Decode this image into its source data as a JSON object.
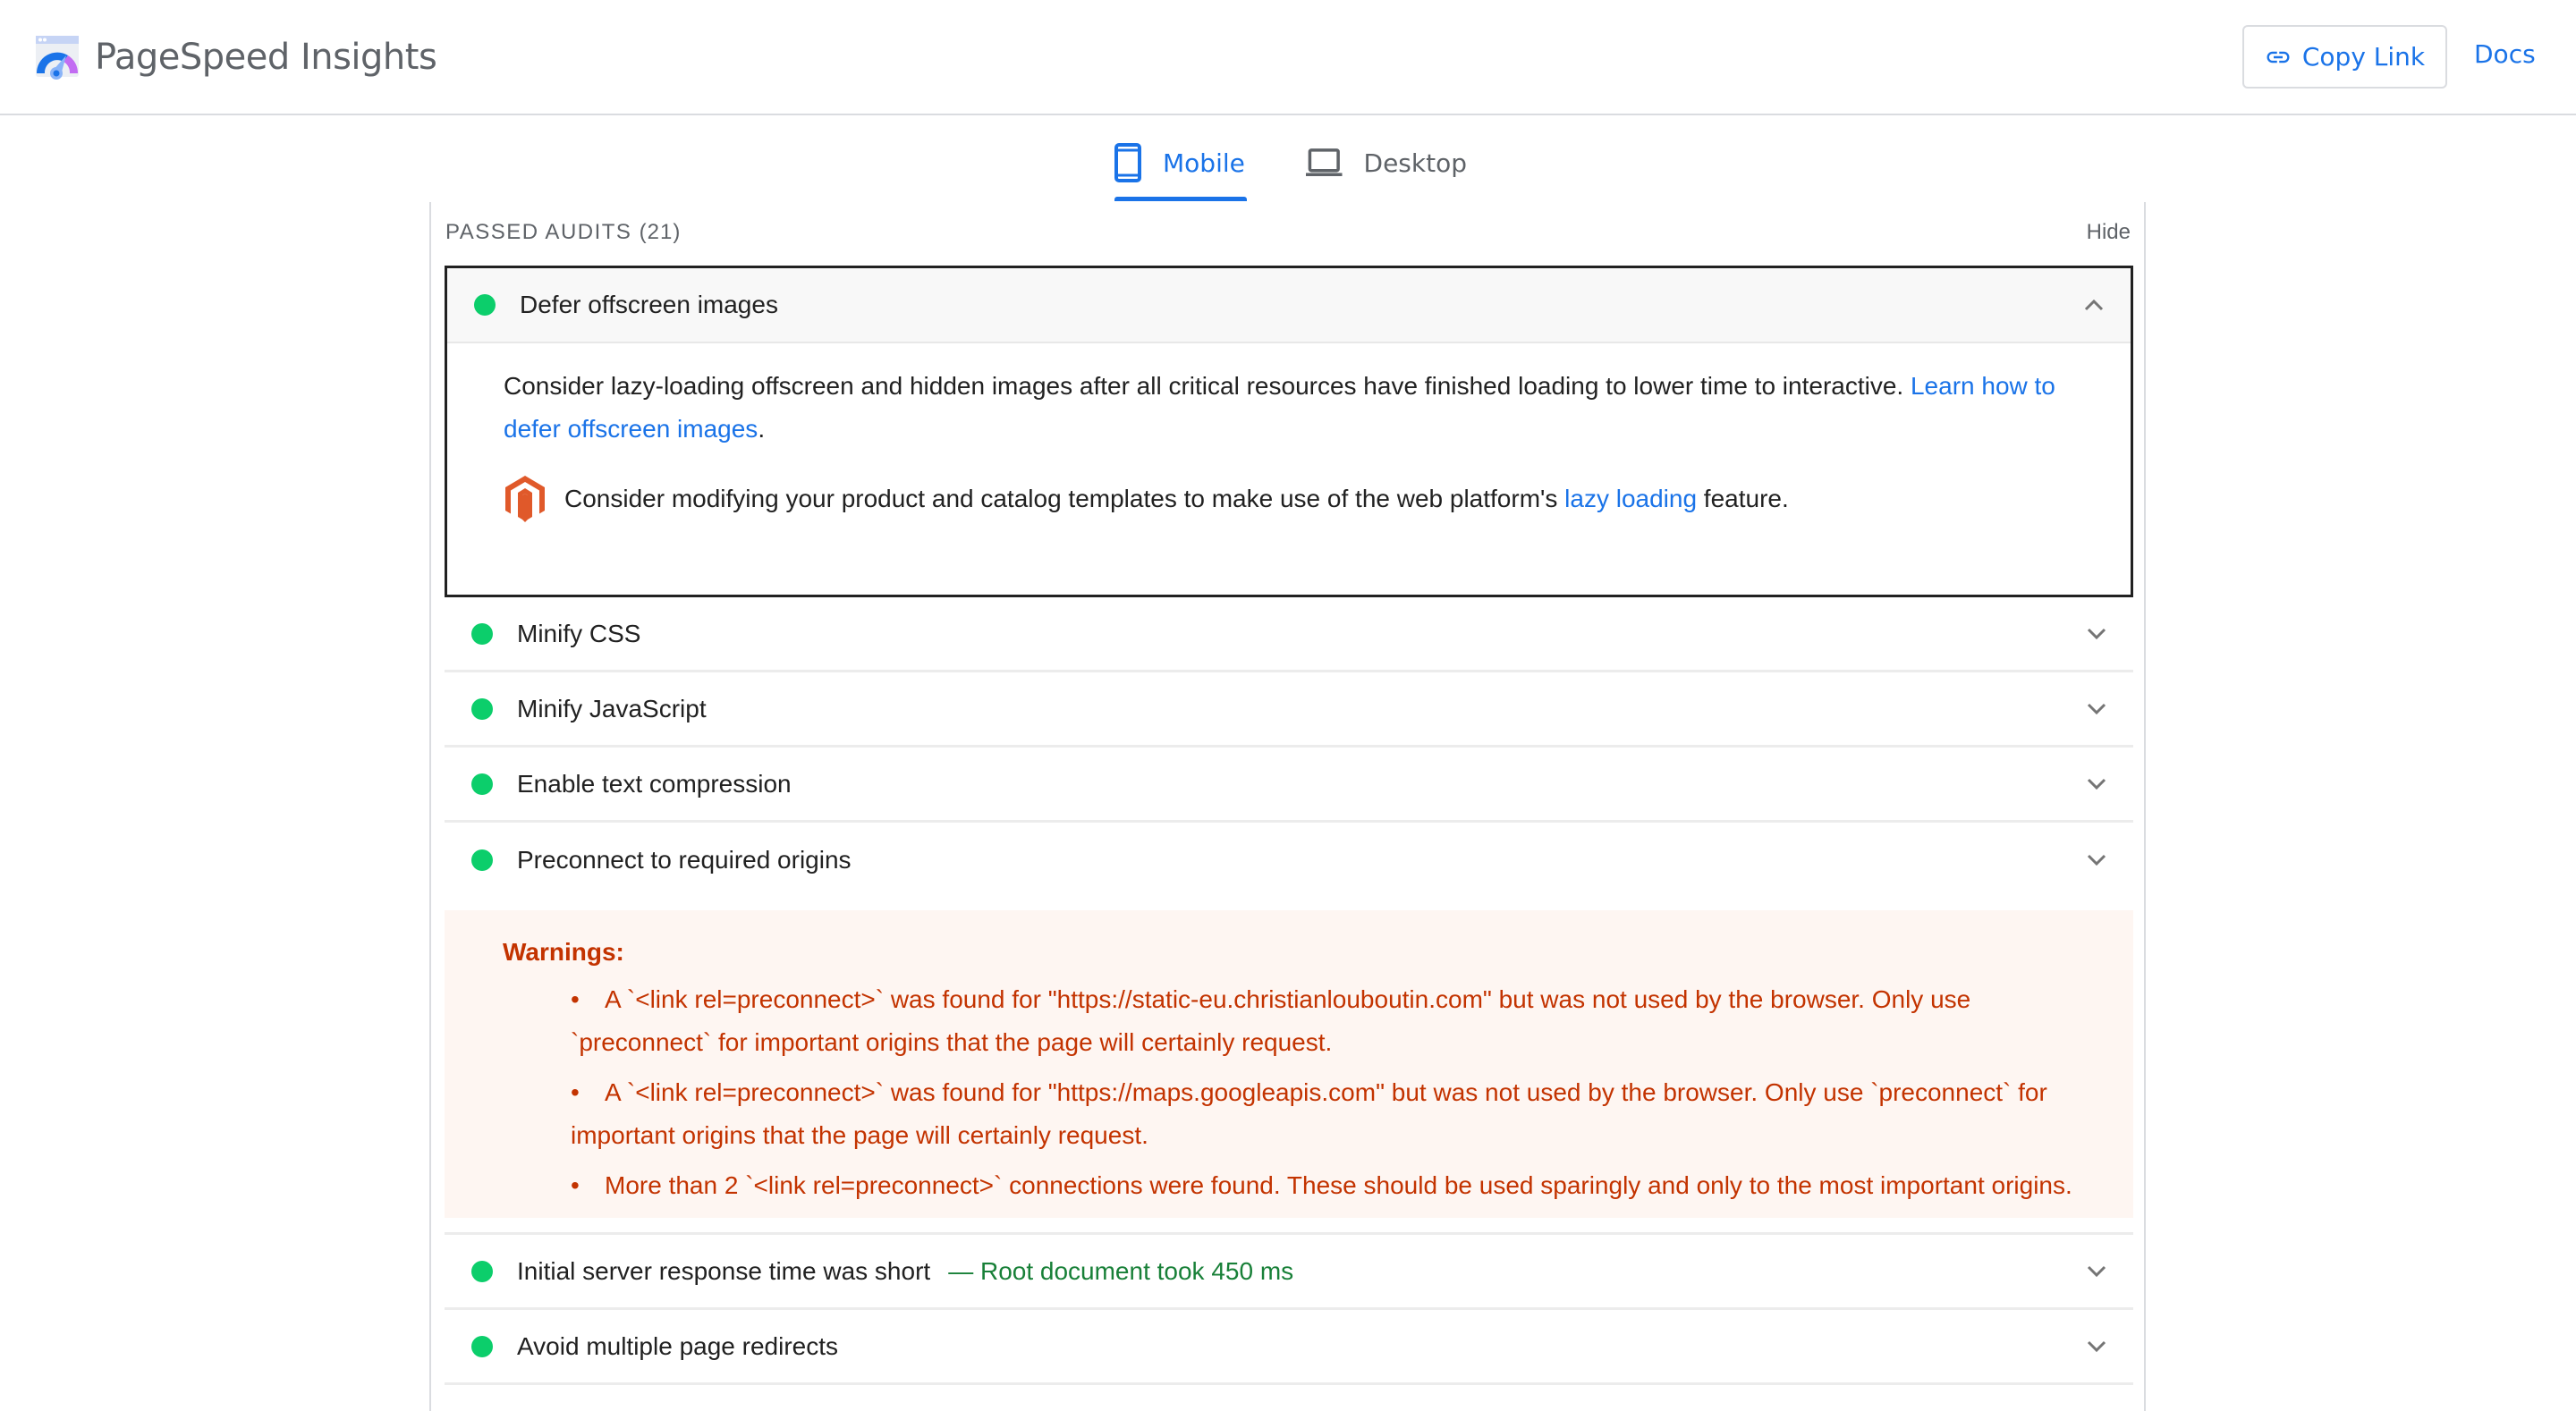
{
  "header": {
    "app_title": "PageSpeed Insights",
    "logo_icon": "pagespeed-gauge-icon",
    "copy_link_label": "Copy Link",
    "copy_link_icon": "link-icon",
    "docs_label": "Docs"
  },
  "tabs": [
    {
      "label": "Mobile",
      "icon": "smartphone-icon",
      "active": true
    },
    {
      "label": "Desktop",
      "icon": "laptop-icon",
      "active": false
    }
  ],
  "colors": {
    "accent": "#1a73e8",
    "pass": "#0cce6b",
    "warning_text": "#c33300",
    "warning_bg": "#fef6f2",
    "display_value": "#188038"
  },
  "section": {
    "title": "PASSED AUDITS",
    "count": "(21)",
    "hide_label": "Hide"
  },
  "expanded_audit": {
    "title": "Defer offscreen images",
    "status": "pass",
    "description_text": "Consider lazy-loading offscreen and hidden images after all critical resources have finished loading to lower time to interactive. ",
    "description_link": "Learn how to defer offscreen images",
    "description_end": ".",
    "stack_pack": {
      "icon": "magento-icon",
      "text_before": "Consider modifying your product and catalog templates to make use of the web platform's ",
      "link": "lazy loading",
      "text_after": " feature."
    }
  },
  "audits": [
    {
      "title": "Minify CSS",
      "status": "pass"
    },
    {
      "title": "Minify JavaScript",
      "status": "pass"
    },
    {
      "title": "Enable text compression",
      "status": "pass"
    },
    {
      "title": "Preconnect to required origins",
      "status": "pass"
    },
    {
      "title": "Initial server response time was short",
      "status": "pass",
      "display_value": "— Root document took 450 ms"
    },
    {
      "title": "Avoid multiple page redirects",
      "status": "pass"
    }
  ],
  "warnings": {
    "title": "Warnings:",
    "items": [
      "A `<link rel=preconnect>` was found for \"https://static-eu.christianlouboutin.com\" but was not used by the browser. Only use `preconnect` for important origins that the page will certainly request.",
      "A `<link rel=preconnect>` was found for \"https://maps.googleapis.com\" but was not used by the browser. Only use `preconnect` for important origins that the page will certainly request.",
      "More than 2 `<link rel=preconnect>` connections were found. These should be used sparingly and only to the most important origins."
    ]
  }
}
